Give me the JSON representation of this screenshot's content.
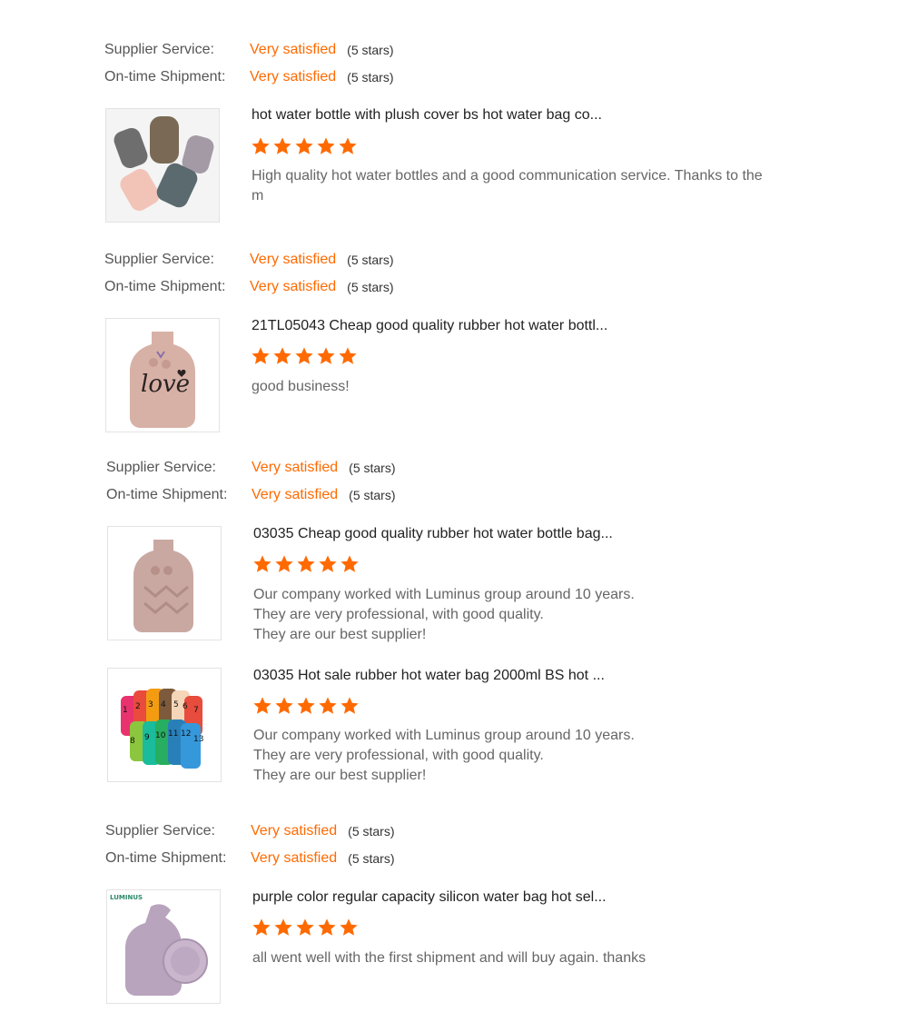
{
  "colors": {
    "accent": "#ff6a00",
    "label": "#555555",
    "comment": "#666666"
  },
  "rating_labels": {
    "supplier": "Supplier Service:",
    "shipment": "On-time Shipment:"
  },
  "reviews": [
    {
      "supplier_value": "Very satisfied",
      "supplier_stars": "(5 stars)",
      "shipment_value": "Very satisfied",
      "shipment_stars": "(5 stars)",
      "items": [
        {
          "title": "hot water bottle with plush cover bs hot water bag co...",
          "stars": 5,
          "comment": [
            "High quality hot water bottles and a good communication service. Thanks to the",
            "m"
          ]
        }
      ]
    },
    {
      "supplier_value": "Very satisfied",
      "supplier_stars": "(5 stars)",
      "shipment_value": "Very satisfied",
      "shipment_stars": "(5 stars)",
      "items": [
        {
          "title": "21TL05043 Cheap good quality rubber hot water bottl...",
          "stars": 5,
          "comment": [
            "good business!"
          ]
        }
      ]
    },
    {
      "supplier_value": "Very satisfied",
      "supplier_stars": "(5 stars)",
      "shipment_value": "Very satisfied",
      "shipment_stars": "(5 stars)",
      "items": [
        {
          "title": "03035 Cheap good quality rubber hot water bottle bag...",
          "stars": 5,
          "comment": [
            "Our company worked with Luminus group around 10 years.",
            "They are very professional, with good quality.",
            "They are our best supplier!"
          ]
        },
        {
          "title": "03035 Hot sale rubber hot water bag 2000ml BS hot ...",
          "stars": 5,
          "comment": [
            "Our company worked with Luminus group around 10 years.",
            "They are very professional, with good quality.",
            "They are our best supplier!"
          ]
        }
      ]
    },
    {
      "supplier_value": "Very satisfied",
      "supplier_stars": "(5 stars)",
      "shipment_value": "Very satisfied",
      "shipment_stars": "(5 stars)",
      "items": [
        {
          "title": "purple color regular capacity silicon water bag hot sel...",
          "stars": 5,
          "comment": [
            "all went well with the first shipment and will buy again. thanks"
          ],
          "logo_text": "LUMINUS"
        }
      ]
    }
  ],
  "images": {
    "love_text": "love",
    "numbers": [
      "1",
      "2",
      "3",
      "4",
      "5",
      "6",
      "7",
      "8",
      "9",
      "10",
      "11",
      "12",
      "13"
    ]
  }
}
